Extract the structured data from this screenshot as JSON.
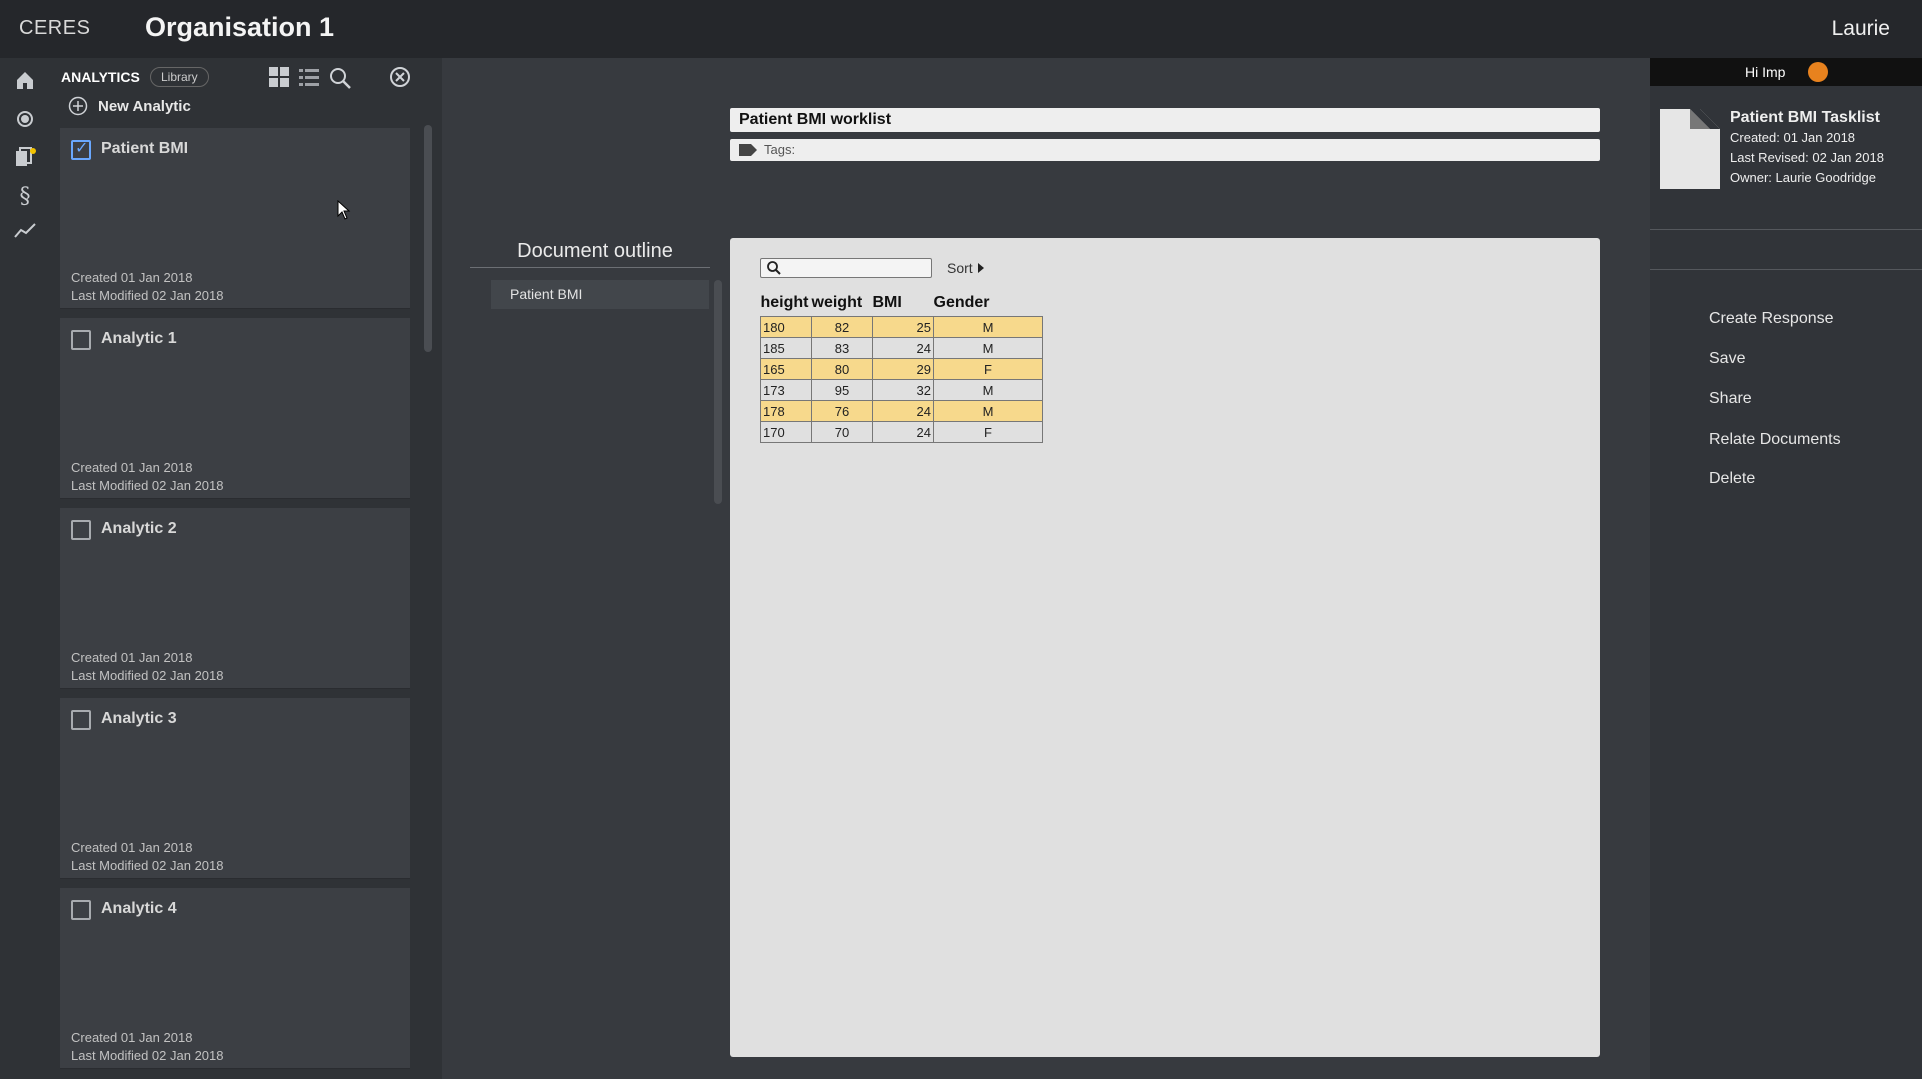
{
  "app": {
    "brand": "CERES",
    "organisation": "Organisation 1",
    "user": "Laurie"
  },
  "rail": {
    "icons": [
      "home-icon",
      "globe-icon",
      "documents-icon",
      "section-icon",
      "analytics-trend-icon"
    ]
  },
  "left_panel": {
    "title": "ANALYTICS",
    "library_label": "Library",
    "new_analytic_label": "New Analytic",
    "cards": [
      {
        "title": "Patient BMI",
        "checked": true,
        "created": "Created 01 Jan 2018",
        "modified": "Last Modified 02 Jan 2018"
      },
      {
        "title": "Analytic 1",
        "checked": false,
        "created": "Created 01 Jan 2018",
        "modified": "Last Modified 02 Jan 2018"
      },
      {
        "title": "Analytic 2",
        "checked": false,
        "created": "Created 01 Jan 2018",
        "modified": "Last Modified 02 Jan 2018"
      },
      {
        "title": "Analytic 3",
        "checked": false,
        "created": "Created 01 Jan 2018",
        "modified": "Last Modified 02 Jan 2018"
      },
      {
        "title": "Analytic 4",
        "checked": false,
        "created": "Created 01 Jan 2018",
        "modified": "Last Modified 02 Jan 2018"
      }
    ]
  },
  "outline": {
    "title": "Document outline",
    "items": [
      "Patient BMI"
    ]
  },
  "document": {
    "name": "Patient BMI worklist",
    "tags_label": "Tags:",
    "search_placeholder": "",
    "sort_label": "Sort",
    "table": {
      "headers": [
        "height",
        "weight",
        "BMI",
        "Gender"
      ],
      "rows": [
        [
          "180",
          "82",
          "25",
          "M"
        ],
        [
          "185",
          "83",
          "24",
          "M"
        ],
        [
          "165",
          "80",
          "29",
          "F"
        ],
        [
          "173",
          "95",
          "32",
          "M"
        ],
        [
          "178",
          "76",
          "24",
          "M"
        ],
        [
          "170",
          "70",
          "24",
          "F"
        ]
      ],
      "highlight_color": "#f7d98c"
    }
  },
  "right_panel": {
    "greeting": "Hi Imp",
    "doc_title": "Patient BMI Tasklist",
    "created": "Created: 01 Jan 2018",
    "revised": "Last Revised: 02 Jan 2018",
    "owner": "Owner:  Laurie Goodridge",
    "actions": [
      "Create Response",
      "Save",
      "Share",
      "Relate Documents",
      "Delete"
    ]
  }
}
